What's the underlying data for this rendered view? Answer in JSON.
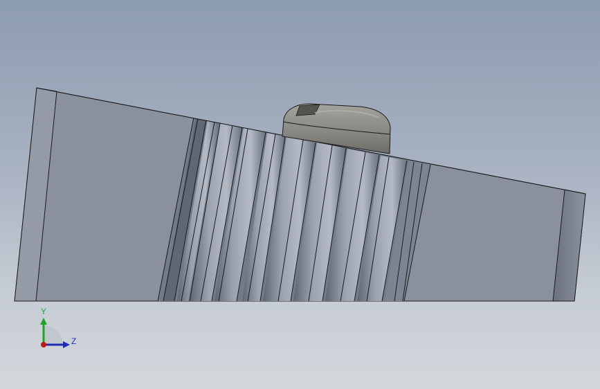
{
  "viewport": {
    "background_top": "#8d9bb0",
    "background_bottom": "#d3d7dc"
  },
  "model": {
    "body_color": "#8a909c",
    "edge_color": "#1a1a1a",
    "knob_color": "#8c8a84"
  },
  "triad": {
    "y_label": "Y",
    "z_label": "Z",
    "y_color": "#1fa32a",
    "z_color": "#1f2fb5",
    "x_color": "#c21818"
  }
}
